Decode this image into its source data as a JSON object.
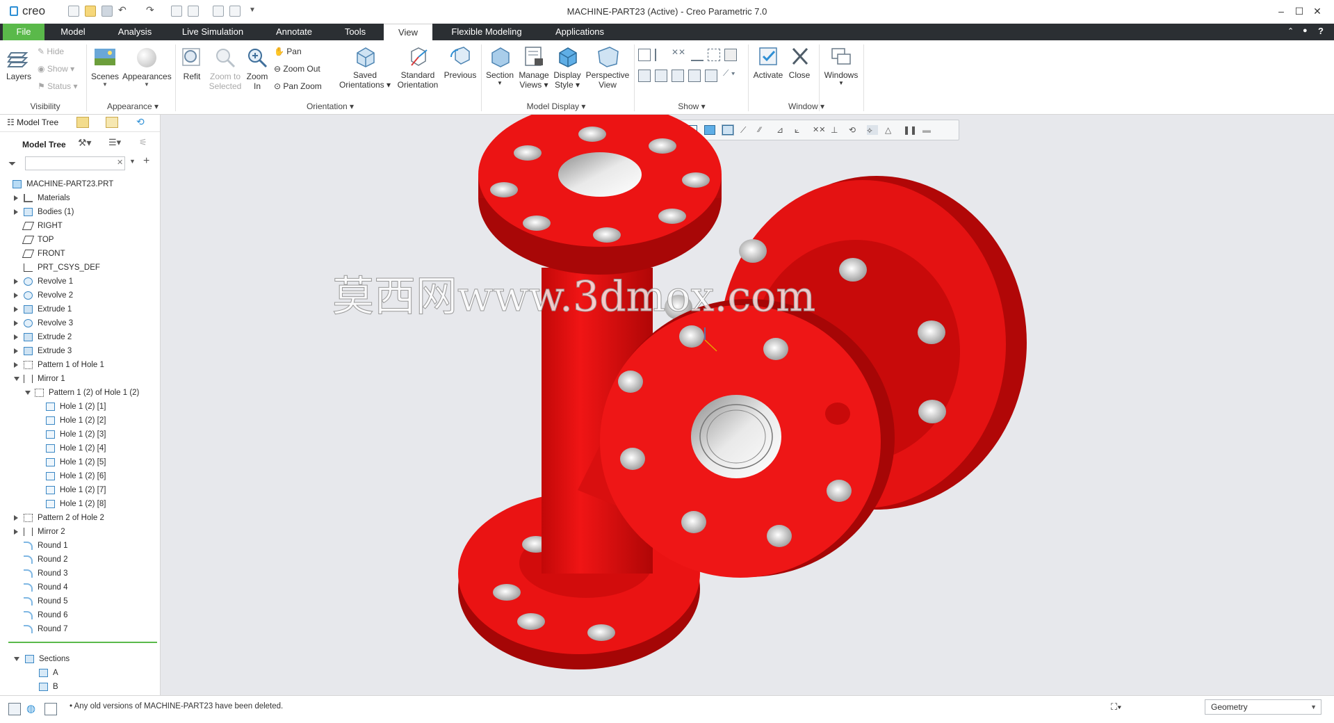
{
  "app": {
    "logo_text": "creo",
    "window_title": "MACHINE-PART23 (Active) - Creo Parametric 7.0",
    "window_buttons": [
      "–",
      "☐",
      "✕"
    ]
  },
  "tabs": [
    {
      "label": "File"
    },
    {
      "label": "Model"
    },
    {
      "label": "Analysis"
    },
    {
      "label": "Live Simulation"
    },
    {
      "label": "Annotate"
    },
    {
      "label": "Tools"
    },
    {
      "label": "View"
    },
    {
      "label": "Flexible Modeling"
    },
    {
      "label": "Applications"
    }
  ],
  "ribbon": {
    "visibility": {
      "layers": "Layers",
      "hide": "Hide",
      "show": "Show",
      "status": "Status",
      "group": "Visibility"
    },
    "appearance": {
      "scenes": "Scenes",
      "appearances": "Appearances",
      "group": "Appearance"
    },
    "orientation": {
      "refit": "Refit",
      "zoom_to_selected_1": "Zoom to",
      "zoom_to_selected_2": "Selected",
      "zoom_in_1": "Zoom",
      "zoom_in_2": "In",
      "pan": "Pan",
      "zoom_out": "Zoom Out",
      "pan_zoom": "Pan Zoom",
      "saved_1": "Saved",
      "saved_2": "Orientations",
      "standard_1": "Standard",
      "standard_2": "Orientation",
      "previous": "Previous",
      "group": "Orientation"
    },
    "model_display": {
      "section": "Section",
      "manage_1": "Manage",
      "manage_2": "Views",
      "display_1": "Display",
      "display_2": "Style",
      "perspective_1": "Perspective",
      "perspective_2": "View",
      "group": "Model Display"
    },
    "show": {
      "group": "Show"
    },
    "window": {
      "activate": "Activate",
      "close": "Close",
      "windows": "Windows",
      "group": "Window"
    }
  },
  "model_tree": {
    "header_tab": "Model Tree",
    "panel_title": "Model Tree",
    "search_placeholder": "",
    "items": [
      {
        "label": "MACHINE-PART23.PRT",
        "icon": "part-icon"
      },
      {
        "label": "Materials",
        "icon": "materials-icon"
      },
      {
        "label": "Bodies (1)",
        "icon": "bodies-icon"
      },
      {
        "label": "RIGHT",
        "icon": "datum-plane-icon"
      },
      {
        "label": "TOP",
        "icon": "datum-plane-icon"
      },
      {
        "label": "FRONT",
        "icon": "datum-plane-icon"
      },
      {
        "label": "PRT_CSYS_DEF",
        "icon": "csys-icon"
      },
      {
        "label": "Revolve 1",
        "icon": "revolve-icon"
      },
      {
        "label": "Revolve 2",
        "icon": "revolve-icon"
      },
      {
        "label": "Extrude 1",
        "icon": "extrude-icon"
      },
      {
        "label": "Revolve 3",
        "icon": "revolve-icon"
      },
      {
        "label": "Extrude 2",
        "icon": "extrude-icon"
      },
      {
        "label": "Extrude 3",
        "icon": "extrude-icon"
      },
      {
        "label": "Pattern 1 of Hole 1",
        "icon": "pattern-icon"
      },
      {
        "label": "Mirror 1",
        "icon": "mirror-icon"
      },
      {
        "label": "Pattern 1 (2) of Hole 1 (2)",
        "icon": "pattern-icon"
      },
      {
        "label": "Hole 1 (2) [1]",
        "icon": "hole-icon"
      },
      {
        "label": "Hole 1 (2) [2]",
        "icon": "hole-icon"
      },
      {
        "label": "Hole 1 (2) [3]",
        "icon": "hole-icon"
      },
      {
        "label": "Hole 1 (2) [4]",
        "icon": "hole-icon"
      },
      {
        "label": "Hole 1 (2) [5]",
        "icon": "hole-icon"
      },
      {
        "label": "Hole 1 (2) [6]",
        "icon": "hole-icon"
      },
      {
        "label": "Hole 1 (2) [7]",
        "icon": "hole-icon"
      },
      {
        "label": "Hole 1 (2) [8]",
        "icon": "hole-icon"
      },
      {
        "label": "Pattern 2 of Hole 2",
        "icon": "pattern-icon"
      },
      {
        "label": "Mirror 2",
        "icon": "mirror-icon"
      },
      {
        "label": "Round 1",
        "icon": "round-icon"
      },
      {
        "label": "Round 2",
        "icon": "round-icon"
      },
      {
        "label": "Round 3",
        "icon": "round-icon"
      },
      {
        "label": "Round 4",
        "icon": "round-icon"
      },
      {
        "label": "Round 5",
        "icon": "round-icon"
      },
      {
        "label": "Round 6",
        "icon": "round-icon"
      },
      {
        "label": "Round 7",
        "icon": "round-icon"
      }
    ],
    "sections": {
      "label": "Sections",
      "items": [
        "A",
        "B"
      ]
    }
  },
  "watermark": "莫西网www.3dmox.com",
  "status": {
    "message": "Any old versions of MACHINE-PART23 have been deleted.",
    "filter_value": "Geometry"
  },
  "colors": {
    "model_red": "#ee1111",
    "file_tab_green": "#5ab94a",
    "tab_bar": "#2b2f33",
    "graphics_bg": "#e7e8ec"
  }
}
